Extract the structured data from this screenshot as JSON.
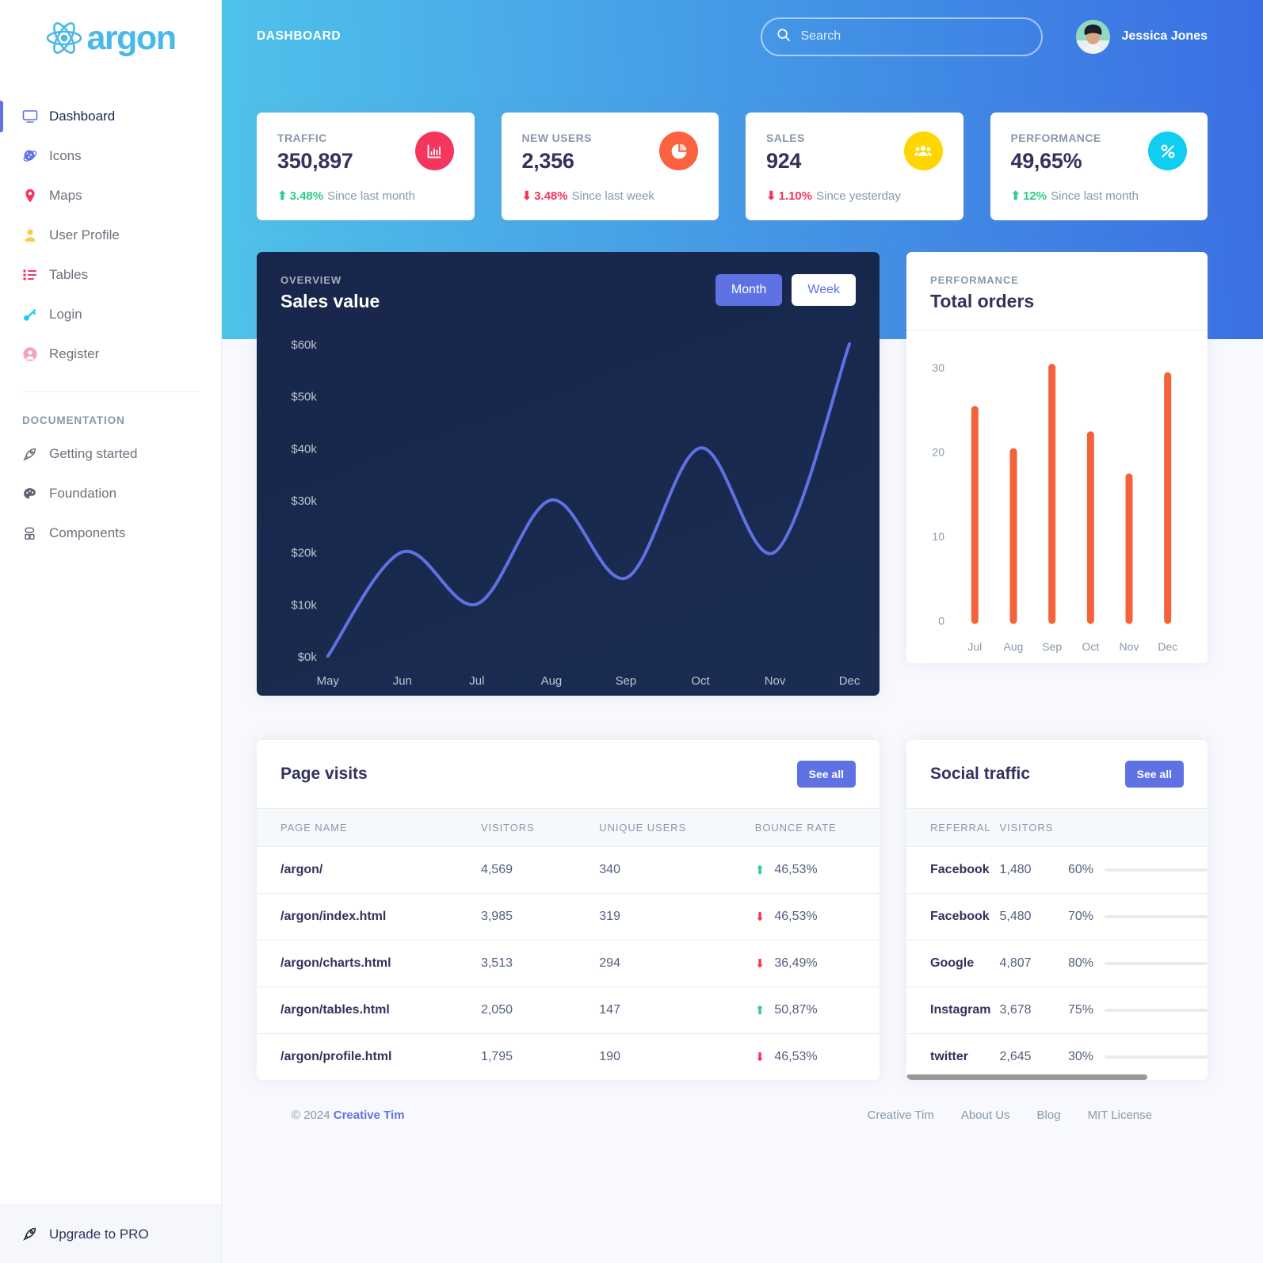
{
  "brand": {
    "name": "argon",
    "icon": "atom-icon"
  },
  "sidebar": {
    "items": [
      {
        "label": "Dashboard",
        "icon": "monitor-icon",
        "color": "#5e72e4",
        "active": true
      },
      {
        "label": "Icons",
        "icon": "atom-small-icon",
        "color": "#5e72e4",
        "active": false
      },
      {
        "label": "Maps",
        "icon": "map-pin-icon",
        "color": "#f5365c",
        "active": false
      },
      {
        "label": "User Profile",
        "icon": "user-icon",
        "color": "#fb6340",
        "active": false
      },
      {
        "label": "Tables",
        "icon": "bullet-list-icon",
        "color": "#f5365c",
        "active": false
      },
      {
        "label": "Login",
        "icon": "key-icon",
        "color": "#11cdef",
        "active": false
      },
      {
        "label": "Register",
        "icon": "user-circle-icon",
        "color": "#f3a4b5",
        "active": false
      }
    ],
    "section_heading": "Documentation",
    "doc_items": [
      {
        "label": "Getting started",
        "icon": "rocket-icon"
      },
      {
        "label": "Foundation",
        "icon": "palette-icon"
      },
      {
        "label": "Components",
        "icon": "components-icon"
      }
    ],
    "upgrade": {
      "label": "Upgrade to PRO",
      "icon": "rocket-icon"
    }
  },
  "topbar": {
    "title": "Dashboard",
    "search": {
      "placeholder": "Search",
      "value": "",
      "icon": "search-icon"
    },
    "user": {
      "name": "Jessica Jones",
      "avatar": "avatar"
    }
  },
  "stats": [
    {
      "label": "Traffic",
      "value": "350,897",
      "icon": "bar-chart-icon",
      "icon_color": "#f5365c",
      "delta": "3.48%",
      "direction": "up",
      "note": "Since last month"
    },
    {
      "label": "New users",
      "value": "2,356",
      "icon": "pie-chart-icon",
      "icon_color": "#fb6340",
      "delta": "3.48%",
      "direction": "down",
      "note": "Since last week"
    },
    {
      "label": "Sales",
      "value": "924",
      "icon": "users-icon",
      "icon_color": "#ffd600",
      "delta": "1.10%",
      "direction": "down",
      "note": "Since yesterday"
    },
    {
      "label": "Performance",
      "value": "49,65%",
      "icon": "percent-icon",
      "icon_color": "#11cdef",
      "delta": "12%",
      "direction": "up",
      "note": "Since last month"
    }
  ],
  "sales_card": {
    "eyebrow": "Overview",
    "title": "Sales value",
    "buttons": [
      {
        "label": "Month",
        "active": true
      },
      {
        "label": "Week",
        "active": false
      }
    ]
  },
  "orders_card": {
    "eyebrow": "Performance",
    "title": "Total orders"
  },
  "page_visits": {
    "title": "Page visits",
    "see_all": "See all",
    "columns": [
      "Page name",
      "Visitors",
      "Unique users",
      "Bounce rate"
    ],
    "rows": [
      {
        "page": "/argon/",
        "visitors": "4,569",
        "unique": "340",
        "bounce": "46,53%",
        "direction": "up"
      },
      {
        "page": "/argon/index.html",
        "visitors": "3,985",
        "unique": "319",
        "bounce": "46,53%",
        "direction": "down"
      },
      {
        "page": "/argon/charts.html",
        "visitors": "3,513",
        "unique": "294",
        "bounce": "36,49%",
        "direction": "down"
      },
      {
        "page": "/argon/tables.html",
        "visitors": "2,050",
        "unique": "147",
        "bounce": "50,87%",
        "direction": "up"
      },
      {
        "page": "/argon/profile.html",
        "visitors": "1,795",
        "unique": "190",
        "bounce": "46,53%",
        "direction": "down"
      }
    ]
  },
  "social_traffic": {
    "title": "Social traffic",
    "see_all": "See all",
    "columns": [
      "Referral",
      "Visitors",
      ""
    ],
    "rows": [
      {
        "referral": "Facebook",
        "visitors": "1,480",
        "pct": "60%",
        "pct_value": 60,
        "color": "#f5365c"
      },
      {
        "referral": "Facebook",
        "visitors": "5,480",
        "pct": "70%",
        "pct_value": 70,
        "color": "#2dce89"
      },
      {
        "referral": "Google",
        "visitors": "4,807",
        "pct": "80%",
        "pct_value": 80,
        "color": "#5e72e4"
      },
      {
        "referral": "Instagram",
        "visitors": "3,678",
        "pct": "75%",
        "pct_value": 75,
        "color": "#11cdef"
      },
      {
        "referral": "twitter",
        "visitors": "2,645",
        "pct": "30%",
        "pct_value": 30,
        "color": "#fb6340"
      }
    ]
  },
  "footer": {
    "copyright": "© 2024",
    "brand_link": "Creative Tim",
    "links": [
      "Creative Tim",
      "About Us",
      "Blog",
      "MIT License"
    ]
  },
  "chart_data": [
    {
      "type": "line",
      "title": "Sales value",
      "subtitle": "Overview",
      "x": [
        "May",
        "Jun",
        "Jul",
        "Aug",
        "Sep",
        "Oct",
        "Nov",
        "Dec"
      ],
      "values": [
        0,
        20,
        10,
        30,
        15,
        40,
        20,
        60
      ],
      "ytick_labels": [
        "$0k",
        "$10k",
        "$20k",
        "$30k",
        "$40k",
        "$50k",
        "$60k"
      ],
      "ytick_values": [
        0,
        10,
        20,
        30,
        40,
        50,
        60
      ],
      "ylim": [
        0,
        60
      ],
      "xlabel": "",
      "ylabel": "",
      "unit": "k USD",
      "grid": false,
      "legend": "none",
      "line_color": "#5e72e4"
    },
    {
      "type": "bar",
      "title": "Total orders",
      "subtitle": "Performance",
      "categories": [
        "Jul",
        "Aug",
        "Sep",
        "Oct",
        "Nov",
        "Dec"
      ],
      "values": [
        25,
        20,
        30,
        22,
        17,
        29
      ],
      "ytick_labels": [
        "0",
        "10",
        "20",
        "30"
      ],
      "ytick_values": [
        0,
        10,
        20,
        30
      ],
      "ylim": [
        0,
        31
      ],
      "xlabel": "",
      "ylabel": "",
      "grid": false,
      "legend": "none",
      "bar_color": "#f4623a"
    }
  ]
}
